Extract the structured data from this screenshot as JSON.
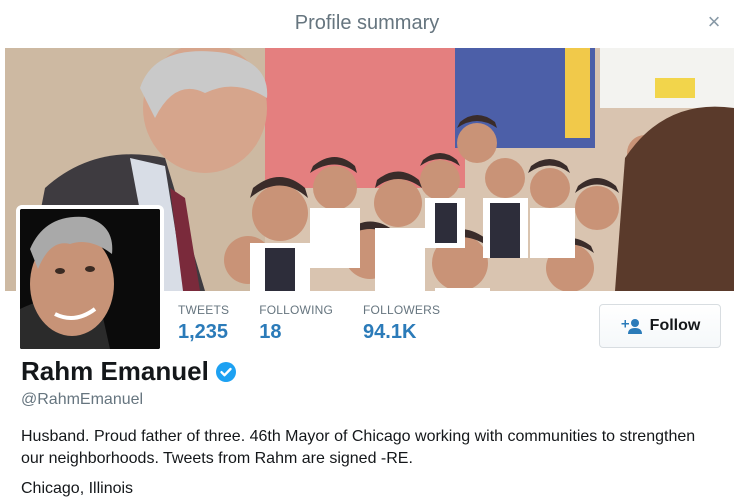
{
  "modal": {
    "title": "Profile summary"
  },
  "profile": {
    "name": "Rahm Emanuel",
    "handle": "@RahmEmanuel",
    "bio": "Husband. Proud father of three. 46th Mayor of Chicago working with communities to strengthen our neighborhoods. Tweets from Rahm are signed -RE.",
    "location": "Chicago, Illinois",
    "verified": true
  },
  "stats": [
    {
      "label": "TWEETS",
      "value": "1,235"
    },
    {
      "label": "FOLLOWING",
      "value": "18"
    },
    {
      "label": "FOLLOWERS",
      "value": "94.1K"
    }
  ],
  "actions": {
    "follow_label": "Follow"
  },
  "icons": {
    "close": "close-icon",
    "follow": "add-user-icon",
    "verified": "verified-badge-icon"
  },
  "colors": {
    "accent": "#2b7bb9",
    "verified": "#1da1f2",
    "muted": "#66757f",
    "text": "#14171a"
  }
}
